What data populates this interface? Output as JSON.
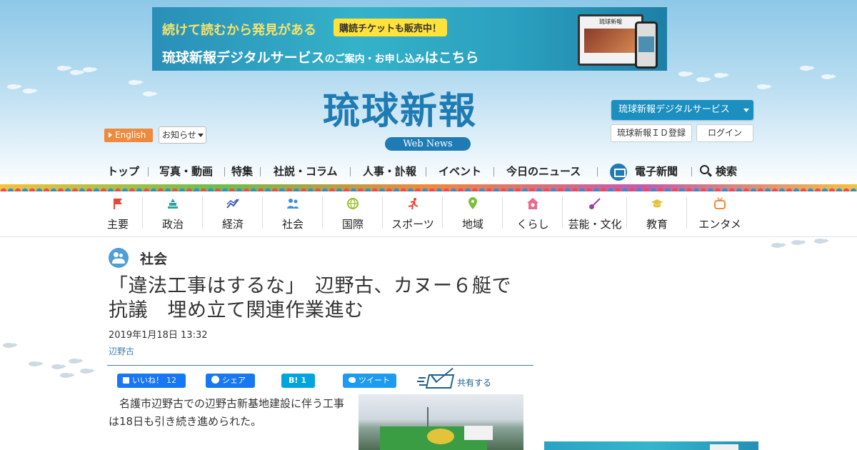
{
  "banner": {
    "line1": "続けて読むから発見がある",
    "tag": "購読チケットも販売中！",
    "line2_main": "琉球新報デジタルサービス",
    "line2_mid": "のご案内・お申し込み",
    "line2_end": "はこちら",
    "device_logo": "琉球新報"
  },
  "header": {
    "logo": "琉球新報",
    "webnews": "Web News",
    "english": "English",
    "notice": "お知らせ",
    "digital_service": "琉球新報デジタルサービス",
    "id_register": "琉球新報ＩＤ登録",
    "login": "ログイン"
  },
  "mainnav": {
    "items": [
      "トップ",
      "写真・動画",
      "特集",
      "社説・コラム",
      "人事・訃報",
      "イベント",
      "今日のニュース",
      "電子新聞",
      "検索"
    ]
  },
  "categories": [
    {
      "label": "主要",
      "icon": "flag-icon",
      "color": "#e2473c"
    },
    {
      "label": "政治",
      "icon": "parliament-icon",
      "color": "#2aa3a3"
    },
    {
      "label": "経済",
      "icon": "chart-icon",
      "color": "#3b5ca8"
    },
    {
      "label": "社会",
      "icon": "people-icon",
      "color": "#3f8fd6"
    },
    {
      "label": "国際",
      "icon": "globe-icon",
      "color": "#9bbf2f"
    },
    {
      "label": "スポーツ",
      "icon": "runner-icon",
      "color": "#e2473c"
    },
    {
      "label": "地域",
      "icon": "pin-icon",
      "color": "#7bbf3a"
    },
    {
      "label": "くらし",
      "icon": "house-icon",
      "color": "#e86b8f"
    },
    {
      "label": "芸能・文化",
      "icon": "sanshin-icon",
      "color": "#9b3fa8"
    },
    {
      "label": "教育",
      "icon": "cap-icon",
      "color": "#e3c33a"
    },
    {
      "label": "エンタメ",
      "icon": "tv-icon",
      "color": "#ef8a3c"
    }
  ],
  "article": {
    "section": "社会",
    "headline": "「違法工事はするな」　辺野古、カヌー６艇で抗議　埋め立て関連作業進む",
    "date": "2019年1月18日 13:32",
    "tag": "辺野古",
    "body": "　名護市辺野古での辺野古新基地建設に伴う工事は18日も引き続き進められた。"
  },
  "share": {
    "like_label": "いいね！",
    "like_count": "12",
    "fb_share_label": "シェア",
    "hatena_label": "B!",
    "hatena_count": "1",
    "tweet_label": "ツイート",
    "mail_label": "共有する"
  }
}
